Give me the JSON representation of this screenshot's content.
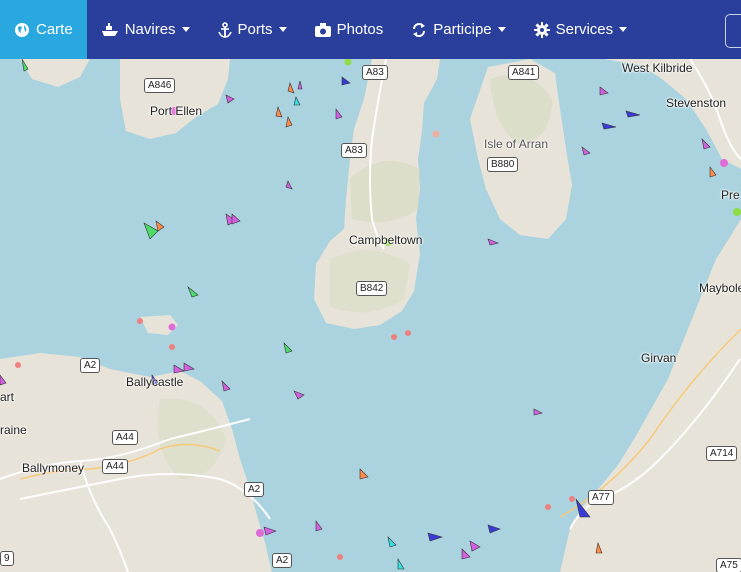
{
  "nav": {
    "carte": "Carte",
    "navires": "Navires",
    "ports": "Ports",
    "photos": "Photos",
    "participe": "Participe",
    "services": "Services"
  },
  "places": {
    "west_kilbride": "West Kilbride",
    "stevenston": "Stevenston",
    "pre": "Pre",
    "port_ellen": "Port Ellen",
    "isle_of_arran": "Isle of Arran",
    "campbeltown": "Campbeltown",
    "maybole": "Maybole",
    "girvan": "Girvan",
    "ballycastle": "Ballycastle",
    "art": "art",
    "raine": "raine",
    "ballymoney": "Ballymoney"
  },
  "roads": {
    "a846": "A846",
    "a83_top": "A83",
    "a83_mid": "A83",
    "a841": "A841",
    "b880": "B880",
    "b842": "B842",
    "a2_left": "A2",
    "a44_a": "A44",
    "a44_b": "A44",
    "a2_mid": "A2",
    "a2_bottom": "A2",
    "a714": "A714",
    "a77": "A77",
    "a75": "A75",
    "nine": "9"
  },
  "colors": {
    "sea": "#aad3df",
    "land": "#e8e3d8",
    "land_highland": "#d7dcc4",
    "nav_bar": "#2a3f9c",
    "nav_active": "#29a8e0",
    "vessel_passenger": "#3a3ad6",
    "vessel_cargo": "#4ddc6a",
    "vessel_pleasure": "#d45fe0",
    "vessel_fishing": "#ff8a4a",
    "vessel_tug": "#35e0e0"
  }
}
